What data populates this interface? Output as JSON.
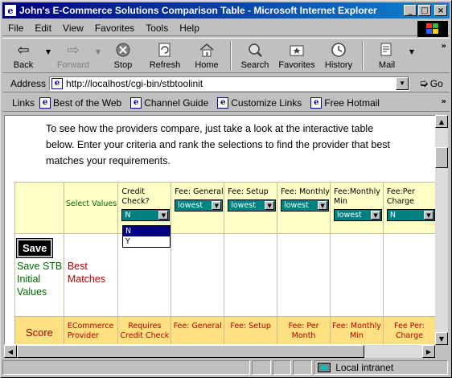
{
  "window": {
    "title": "John's E-Commerce Solutions Comparison Table - Microsoft Internet Explorer",
    "min_glyph": "_",
    "max_glyph": "□",
    "close_glyph": "×"
  },
  "menu": [
    "File",
    "Edit",
    "View",
    "Favorites",
    "Tools",
    "Help"
  ],
  "toolbar": {
    "back": "Back",
    "forward": "Forward",
    "stop": "Stop",
    "refresh": "Refresh",
    "home": "Home",
    "search": "Search",
    "favorites": "Favorites",
    "history": "History",
    "mail": "Mail",
    "more": "»"
  },
  "address": {
    "label": "Address",
    "url": "http://localhost/cgi-bin/stbtoolinit",
    "go": "Go"
  },
  "links": {
    "label": "Links",
    "items": [
      "Best of the Web",
      "Channel Guide",
      "Customize Links",
      "Free Hotmail"
    ],
    "more": "»"
  },
  "intro_text": "To see how the providers compare, just take a look at the interactive table below. Enter your criteria and rank the selections to find the provider that best matches your requirements.",
  "table": {
    "select_values": "Select Values",
    "columns": [
      {
        "label": "Credit Check?",
        "value": "N"
      },
      {
        "label": "Fee: General",
        "value": "lowest"
      },
      {
        "label": "Fee: Setup",
        "value": "lowest"
      },
      {
        "label": "Fee: Monthly",
        "value": "lowest"
      },
      {
        "label": "Fee:Monthly Min",
        "value": "lowest"
      },
      {
        "label": "Fee:Per Charge",
        "value": "N"
      }
    ],
    "dropdown_options": [
      "N",
      "Y"
    ],
    "save_button": "Save",
    "save_text": "Save STB Initial Values",
    "best_matches": "Best Matches",
    "score": "Score",
    "footer": [
      "ECommerce Provider",
      "Requires Credit Check",
      "Fee: General",
      "Fee: Setup",
      "Fee: Per Month",
      "Fee: Monthly Min",
      "Fee Per: Charge"
    ]
  },
  "status": {
    "zone": "Local intranet"
  }
}
